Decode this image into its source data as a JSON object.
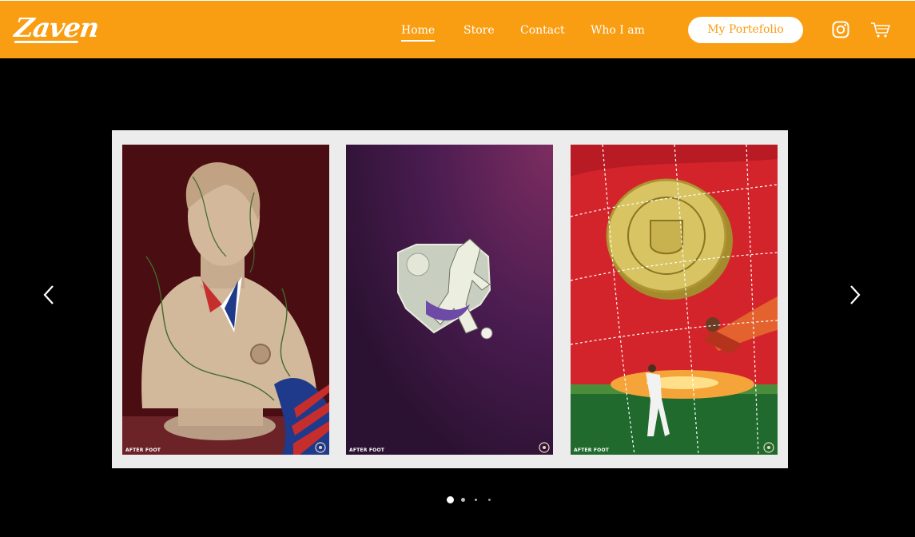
{
  "brand": {
    "logo_text": "Zaven"
  },
  "nav": {
    "items": [
      {
        "label": "Home",
        "active": true
      },
      {
        "label": "Store",
        "active": false
      },
      {
        "label": "Contact",
        "active": false
      },
      {
        "label": "Who I am",
        "active": false
      }
    ],
    "portfolio_button": "My Portefolio"
  },
  "icons": {
    "social": "instagram-icon",
    "cart": "cart-icon",
    "prev": "chevron-left-icon",
    "next": "chevron-right-icon"
  },
  "gallery": {
    "slides": [
      {
        "caption": "AFTER FOOT",
        "subject": "bust-statue-with-flag"
      },
      {
        "caption": "AFTER FOOT",
        "subject": "footballer-on-banknote"
      },
      {
        "caption": "AFTER FOOT",
        "subject": "portugal-coin-goalkeeper"
      }
    ],
    "pagination": {
      "count": 4,
      "active_index": 0
    }
  },
  "colors": {
    "header": "#f99d12",
    "background": "#000000",
    "frame": "#ececec"
  }
}
